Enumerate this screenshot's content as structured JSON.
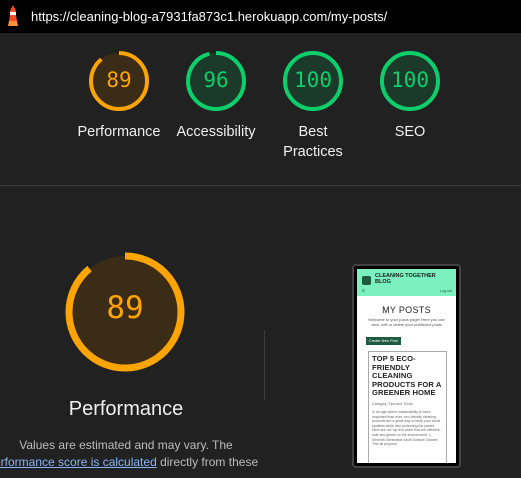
{
  "url": "https://cleaning-blog-a7931fa873c1.herokuapp.com/my-posts/",
  "colors": {
    "orange": "#ffa400",
    "orange_bg": "#3a2c16",
    "green": "#0cce6b",
    "green_bg": "#1c3a2a"
  },
  "icons": {
    "lighthouse": "lighthouse-icon"
  },
  "categories": [
    {
      "label": "Performance",
      "score": 89,
      "status": "average"
    },
    {
      "label": "Accessibility",
      "score": 96,
      "status": "pass"
    },
    {
      "label": "Best Practices",
      "score": 100,
      "status": "pass"
    },
    {
      "label": "SEO",
      "score": 100,
      "status": "pass"
    }
  ],
  "performance": {
    "score": 89,
    "title": "Performance",
    "note_line1": "Values are estimated and may vary. The",
    "link_text": "erformance score is calculated",
    "note_line2_rest": " directly from these"
  },
  "preview": {
    "brand": "CLEANING TOGETHER BLOG",
    "menu_icon": "≡",
    "login": "Log out",
    "page_title": "MY POSTS",
    "intro": "Welcome to your posts page! Here you can view, edit or delete your published posts",
    "button": "Create New Post",
    "card_title": "TOP 5 ECO-FRIENDLY CLEANING PRODUCTS FOR A GREENER HOME",
    "card_category": "Category: Tips and Tricks",
    "card_body": "In an age where sustainability is more important than ever, eco-friendly cleaning products are a great way to keep your home spotless while also protecting the planet. Here are our top five picks that are effective, safe and gentle on the environment. 1. Seventh Generation Multi Surface Cleaner This all purpose"
  }
}
